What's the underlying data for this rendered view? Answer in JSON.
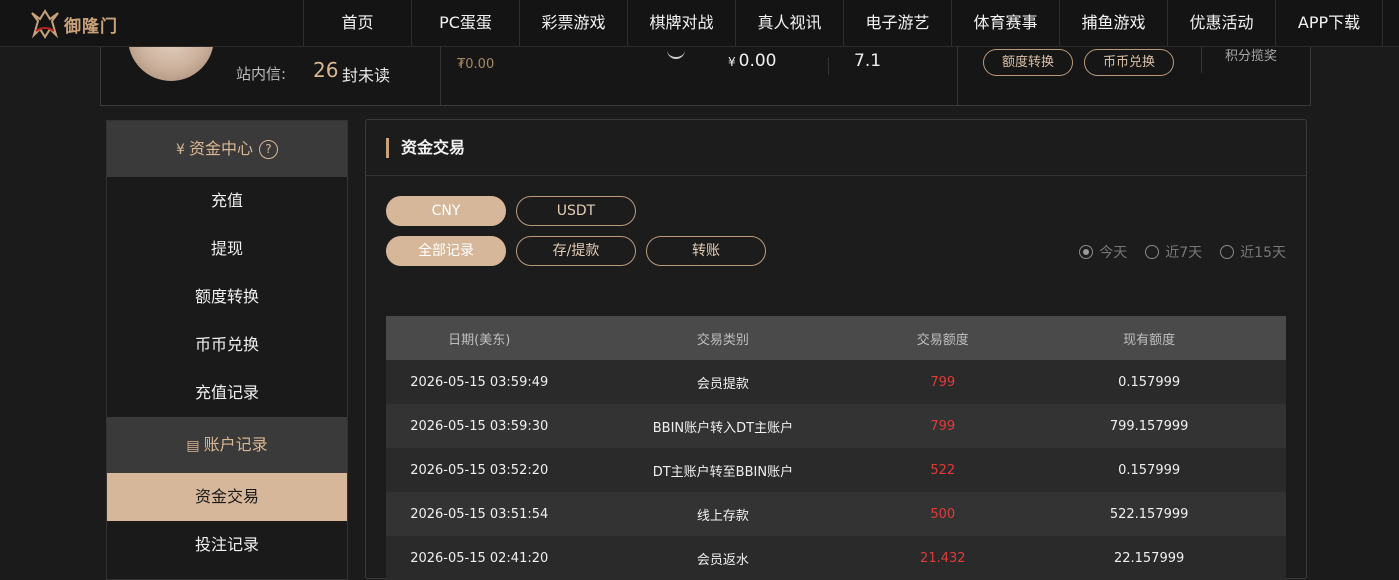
{
  "brand": {
    "logo_text": "御隆门"
  },
  "nav": {
    "items": [
      "首页",
      "PC蛋蛋",
      "彩票游戏",
      "棋牌对战",
      "真人视讯",
      "电子游艺",
      "体育赛事",
      "捕鱼游戏",
      "优惠活动",
      "APP下载"
    ]
  },
  "summary": {
    "inbox_label": "站内信:",
    "inbox_count": "26",
    "inbox_unit": "封未读",
    "balance_small": "₮0.00",
    "balance_currency": "¥",
    "balance_main": "0.00",
    "vip_value": "7.1",
    "transfer_button": "额度转换",
    "exchange_button": "币币兑换",
    "points_text": "积分揽奖"
  },
  "sidebar": {
    "section1_title": "资金中心",
    "section1_help": "?",
    "section1_items": [
      "充值",
      "提现",
      "额度转换",
      "币币兑换",
      "充值记录"
    ],
    "section2_title": "账户记录",
    "section2_items": [
      "资金交易",
      "投注记录"
    ],
    "active_item": "资金交易"
  },
  "main": {
    "title": "资金交易",
    "currency_tabs": [
      "CNY",
      "USDT"
    ],
    "active_currency": "CNY",
    "record_tabs": [
      "全部记录",
      "存/提款",
      "转账"
    ],
    "active_record": "全部记录",
    "range_options": [
      "今天",
      "近7天",
      "近15天"
    ],
    "active_range": "今天"
  },
  "table": {
    "headers": [
      "日期(美东)",
      "交易类别",
      "交易额度",
      "现有额度"
    ],
    "rows": [
      [
        "2026-05-15 03:59:49",
        "会员提款",
        "799",
        "0.157999"
      ],
      [
        "2026-05-15 03:59:30",
        "BBIN账户转入DT主账户",
        "799",
        "799.157999"
      ],
      [
        "2026-05-15 03:52:20",
        "DT主账户转至BBIN账户",
        "522",
        "0.157999"
      ],
      [
        "2026-05-15 03:51:54",
        "线上存款",
        "500",
        "522.157999"
      ],
      [
        "2026-05-15 02:41:20",
        "会员返水",
        "21.432",
        "22.157999"
      ]
    ]
  },
  "colors": {
    "accent": "#d6b79a",
    "gold_text": "#d9b792",
    "amount_red": "#e03b3b",
    "background": "#1b1b1b"
  },
  "icons": {
    "logo": "dragon-logo-icon",
    "fund_center": "yen-coin-icon",
    "help": "help-circle-icon",
    "account_records": "ledger-icon",
    "refresh": "refresh-icon"
  }
}
